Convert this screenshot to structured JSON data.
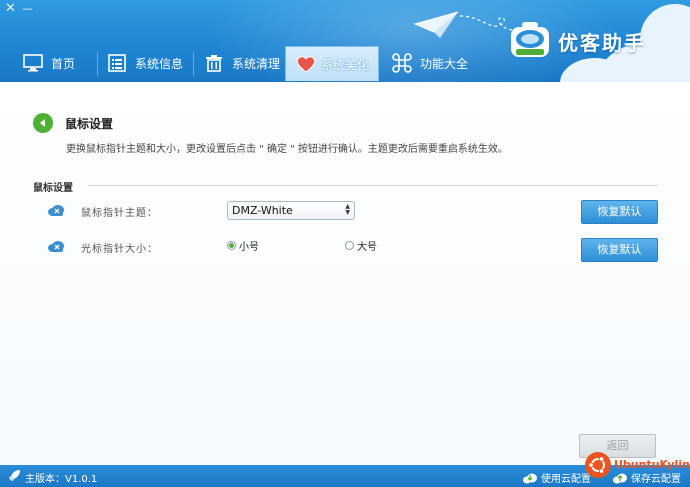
{
  "window": {
    "close_glyph": "✕",
    "minimize_glyph": "—"
  },
  "brand": {
    "name": "优客助手"
  },
  "tabs": [
    {
      "label": "首页",
      "icon": "monitor-icon",
      "active": false
    },
    {
      "label": "系统信息",
      "icon": "list-icon",
      "active": false
    },
    {
      "label": "系统清理",
      "icon": "trash-icon",
      "active": false
    },
    {
      "label": "系统美化",
      "icon": "heart-icon",
      "active": true
    },
    {
      "label": "功能大全",
      "icon": "command-icon",
      "active": false
    }
  ],
  "section": {
    "title": "鼠标设置",
    "description": "更换鼠标指针主题和大小，更改设置后点击 \" 确定 \" 按钮进行确认。主题更改后需要重启系统生效。"
  },
  "group": {
    "label": "鼠标设置"
  },
  "rows": {
    "theme": {
      "label": "鼠标指针主题：",
      "selected": "DMZ-White",
      "reset": "恢复默认"
    },
    "size": {
      "label": "光标指针大小：",
      "option_small": "小号",
      "option_large": "大号",
      "selected": "小号",
      "reset": "恢复默认"
    }
  },
  "back_button": "返回",
  "status": {
    "version": "主版本：V1.0.1",
    "use_cloud": "使用云配置",
    "save_cloud": "保存云配置"
  },
  "watermark": "UbuntuKylin",
  "colors": {
    "header_blue": "#1f86d4",
    "accent_green": "#4fae36",
    "button_blue": "#2f8fd6",
    "ubuntu_orange": "#e95420"
  }
}
